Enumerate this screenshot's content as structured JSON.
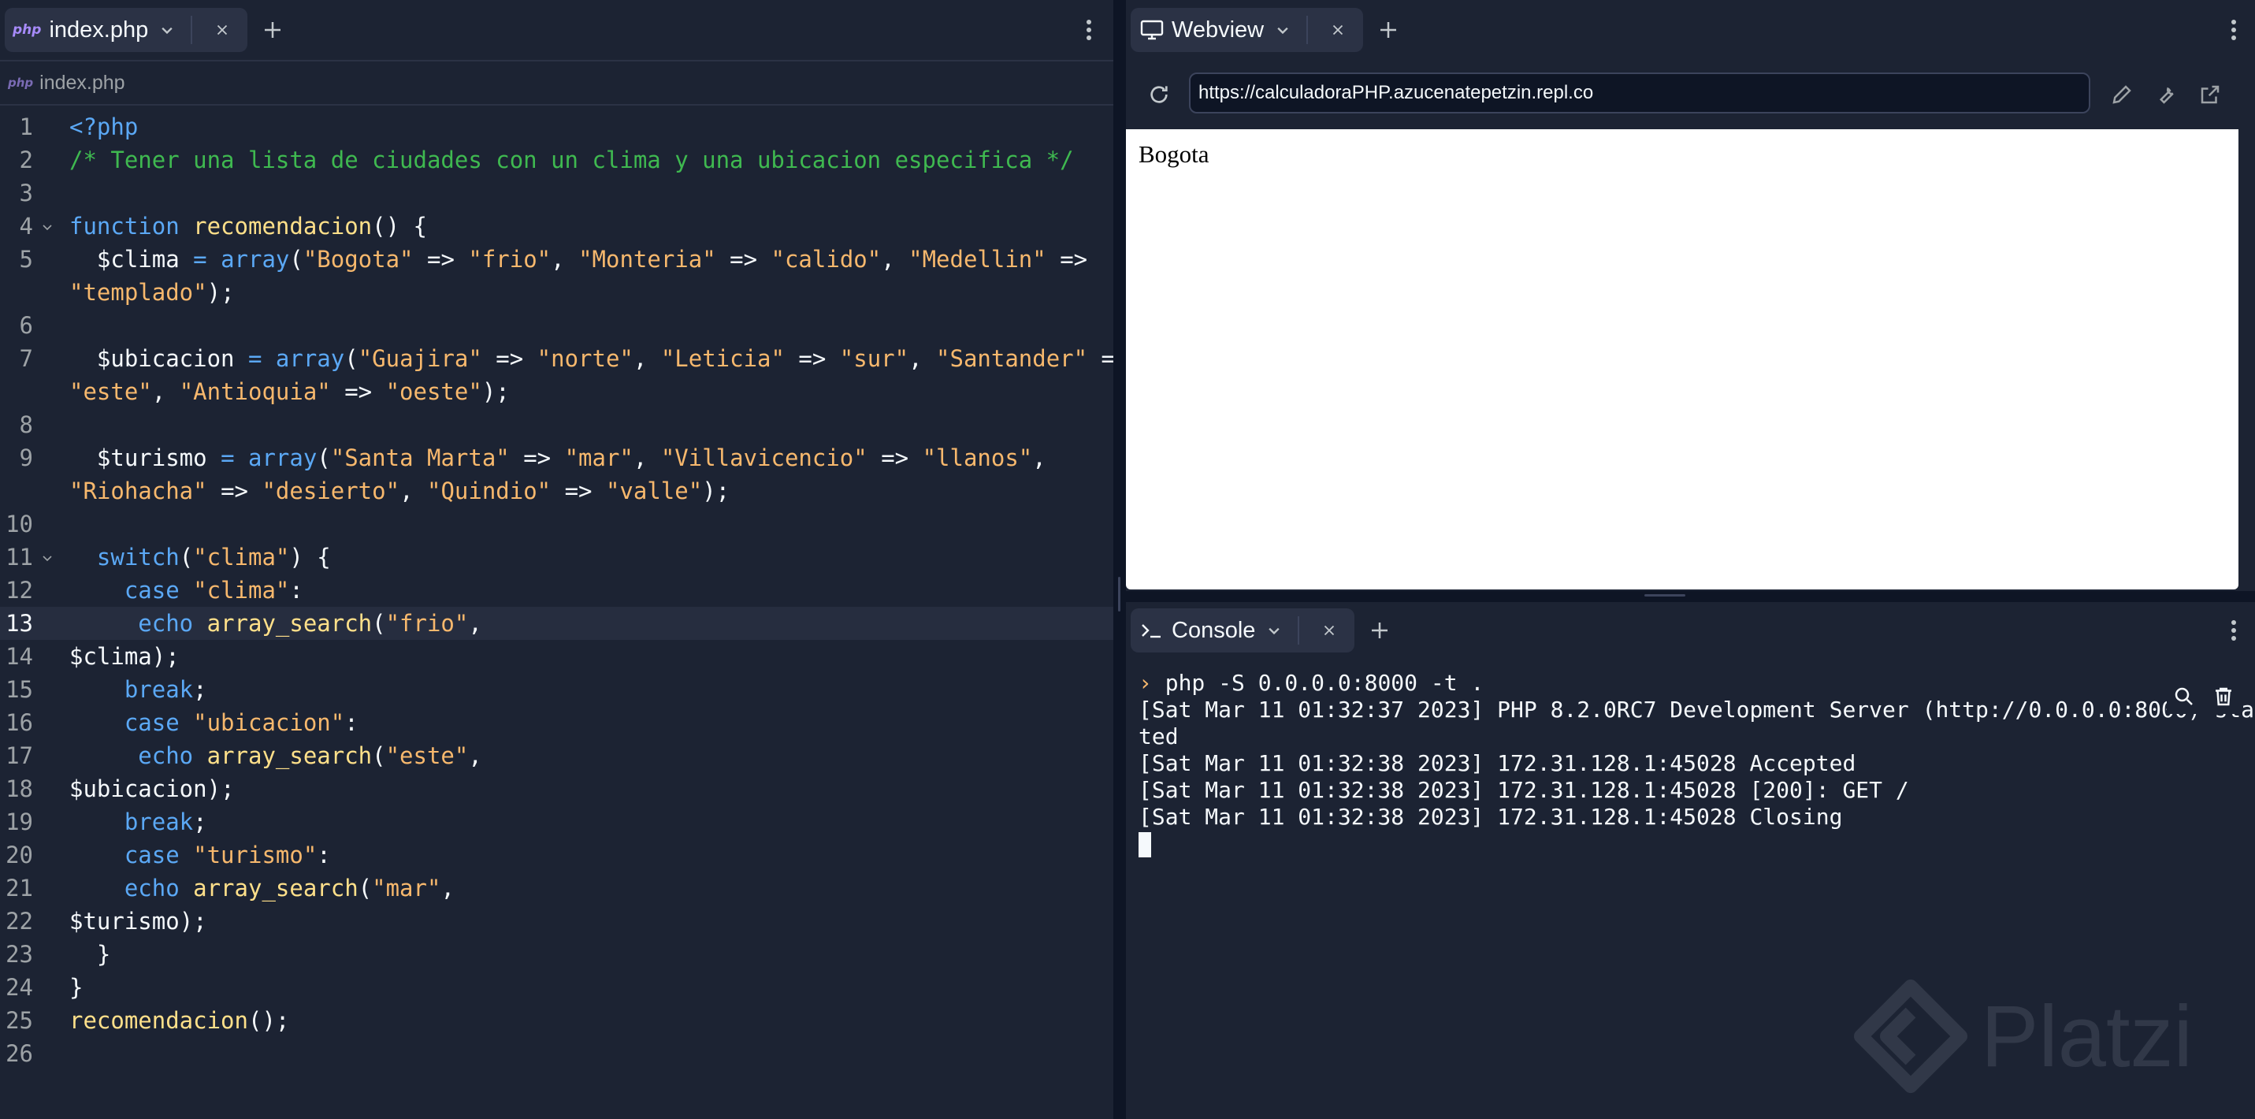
{
  "editor": {
    "tab_label": "index.php",
    "tab_badge": "php",
    "breadcrumb_badge": "php",
    "breadcrumb_label": "index.php",
    "code_lines": [
      {
        "n": "1",
        "fold": false,
        "tokens": [
          {
            "t": "kw",
            "v": "<?php"
          }
        ]
      },
      {
        "n": "2",
        "fold": false,
        "tokens": [
          {
            "t": "cm",
            "v": "/* Tener una lista de ciudades con un clima y una ubicacion especifica */"
          }
        ]
      },
      {
        "n": "3",
        "fold": false,
        "tokens": []
      },
      {
        "n": "4",
        "fold": true,
        "tokens": [
          {
            "t": "kw",
            "v": "function "
          },
          {
            "t": "fn",
            "v": "recomendacion"
          },
          {
            "t": "pn",
            "v": "() {"
          }
        ]
      },
      {
        "n": "5",
        "fold": false,
        "tokens": [
          {
            "t": "var",
            "v": "  $clima "
          },
          {
            "t": "kw",
            "v": "= "
          },
          {
            "t": "kw",
            "v": "array"
          },
          {
            "t": "pn",
            "v": "("
          },
          {
            "t": "str",
            "v": "\"Bogota\""
          },
          {
            "t": "pn",
            "v": " => "
          },
          {
            "t": "str",
            "v": "\"frio\""
          },
          {
            "t": "pn",
            "v": ", "
          },
          {
            "t": "str",
            "v": "\"Monteria\""
          },
          {
            "t": "pn",
            "v": " => "
          },
          {
            "t": "str",
            "v": "\"calido\""
          },
          {
            "t": "pn",
            "v": ", "
          },
          {
            "t": "str",
            "v": "\"Medellin\""
          },
          {
            "t": "pn",
            "v": " =>"
          }
        ]
      },
      {
        "n": "",
        "fold": false,
        "tokens": [
          {
            "t": "str",
            "v": "\"templado\""
          },
          {
            "t": "pn",
            "v": ");"
          }
        ]
      },
      {
        "n": "6",
        "fold": false,
        "tokens": []
      },
      {
        "n": "7",
        "fold": false,
        "tokens": [
          {
            "t": "var",
            "v": "  $ubicacion "
          },
          {
            "t": "kw",
            "v": "= "
          },
          {
            "t": "kw",
            "v": "array"
          },
          {
            "t": "pn",
            "v": "("
          },
          {
            "t": "str",
            "v": "\"Guajira\""
          },
          {
            "t": "pn",
            "v": " => "
          },
          {
            "t": "str",
            "v": "\"norte\""
          },
          {
            "t": "pn",
            "v": ", "
          },
          {
            "t": "str",
            "v": "\"Leticia\""
          },
          {
            "t": "pn",
            "v": " => "
          },
          {
            "t": "str",
            "v": "\"sur\""
          },
          {
            "t": "pn",
            "v": ", "
          },
          {
            "t": "str",
            "v": "\"Santander\""
          },
          {
            "t": "pn",
            "v": " =>"
          }
        ]
      },
      {
        "n": "",
        "fold": false,
        "tokens": [
          {
            "t": "str",
            "v": "\"este\""
          },
          {
            "t": "pn",
            "v": ", "
          },
          {
            "t": "str",
            "v": "\"Antioquia\""
          },
          {
            "t": "pn",
            "v": " => "
          },
          {
            "t": "str",
            "v": "\"oeste\""
          },
          {
            "t": "pn",
            "v": ");"
          }
        ]
      },
      {
        "n": "8",
        "fold": false,
        "tokens": []
      },
      {
        "n": "9",
        "fold": false,
        "tokens": [
          {
            "t": "var",
            "v": "  $turismo "
          },
          {
            "t": "kw",
            "v": "= "
          },
          {
            "t": "kw",
            "v": "array"
          },
          {
            "t": "pn",
            "v": "("
          },
          {
            "t": "str",
            "v": "\"Santa Marta\""
          },
          {
            "t": "pn",
            "v": " => "
          },
          {
            "t": "str",
            "v": "\"mar\""
          },
          {
            "t": "pn",
            "v": ", "
          },
          {
            "t": "str",
            "v": "\"Villavicencio\""
          },
          {
            "t": "pn",
            "v": " => "
          },
          {
            "t": "str",
            "v": "\"llanos\""
          },
          {
            "t": "pn",
            "v": ","
          }
        ]
      },
      {
        "n": "",
        "fold": false,
        "tokens": [
          {
            "t": "str",
            "v": "\"Riohacha\""
          },
          {
            "t": "pn",
            "v": " => "
          },
          {
            "t": "str",
            "v": "\"desierto\""
          },
          {
            "t": "pn",
            "v": ", "
          },
          {
            "t": "str",
            "v": "\"Quindio\""
          },
          {
            "t": "pn",
            "v": " => "
          },
          {
            "t": "str",
            "v": "\"valle\""
          },
          {
            "t": "pn",
            "v": ");"
          }
        ]
      },
      {
        "n": "10",
        "fold": false,
        "tokens": []
      },
      {
        "n": "11",
        "fold": true,
        "tokens": [
          {
            "t": "kw",
            "v": "  switch"
          },
          {
            "t": "pn",
            "v": "("
          },
          {
            "t": "str",
            "v": "\"clima\""
          },
          {
            "t": "pn",
            "v": ") {"
          }
        ]
      },
      {
        "n": "12",
        "fold": false,
        "tokens": [
          {
            "t": "kw",
            "v": "    case "
          },
          {
            "t": "str",
            "v": "\"clima\""
          },
          {
            "t": "pn",
            "v": ":"
          }
        ]
      },
      {
        "n": "13",
        "fold": false,
        "active": true,
        "tokens": [
          {
            "t": "kw",
            "v": "     echo "
          },
          {
            "t": "fn",
            "v": "array_search"
          },
          {
            "t": "pn",
            "v": "("
          },
          {
            "t": "str",
            "v": "\"frio\""
          },
          {
            "t": "pn",
            "v": ","
          }
        ]
      },
      {
        "n": "14",
        "fold": false,
        "tokens": [
          {
            "t": "var",
            "v": "$clima"
          },
          {
            "t": "pn",
            "v": ");"
          }
        ]
      },
      {
        "n": "15",
        "fold": false,
        "tokens": [
          {
            "t": "kw",
            "v": "    break"
          },
          {
            "t": "pn",
            "v": ";"
          }
        ]
      },
      {
        "n": "16",
        "fold": false,
        "tokens": [
          {
            "t": "kw",
            "v": "    case "
          },
          {
            "t": "str",
            "v": "\"ubicacion\""
          },
          {
            "t": "pn",
            "v": ":"
          }
        ]
      },
      {
        "n": "17",
        "fold": false,
        "tokens": [
          {
            "t": "kw",
            "v": "     echo "
          },
          {
            "t": "fn",
            "v": "array_search"
          },
          {
            "t": "pn",
            "v": "("
          },
          {
            "t": "str",
            "v": "\"este\""
          },
          {
            "t": "pn",
            "v": ","
          }
        ]
      },
      {
        "n": "18",
        "fold": false,
        "tokens": [
          {
            "t": "var",
            "v": "$ubicacion"
          },
          {
            "t": "pn",
            "v": ");"
          }
        ]
      },
      {
        "n": "19",
        "fold": false,
        "tokens": [
          {
            "t": "kw",
            "v": "    break"
          },
          {
            "t": "pn",
            "v": ";"
          }
        ]
      },
      {
        "n": "20",
        "fold": false,
        "tokens": [
          {
            "t": "kw",
            "v": "    case "
          },
          {
            "t": "str",
            "v": "\"turismo\""
          },
          {
            "t": "pn",
            "v": ":"
          }
        ]
      },
      {
        "n": "21",
        "fold": false,
        "tokens": [
          {
            "t": "kw",
            "v": "    echo "
          },
          {
            "t": "fn",
            "v": "array_search"
          },
          {
            "t": "pn",
            "v": "("
          },
          {
            "t": "str",
            "v": "\"mar\""
          },
          {
            "t": "pn",
            "v": ","
          }
        ]
      },
      {
        "n": "22",
        "fold": false,
        "tokens": [
          {
            "t": "var",
            "v": "$turismo"
          },
          {
            "t": "pn",
            "v": ");"
          }
        ]
      },
      {
        "n": "23",
        "fold": false,
        "tokens": [
          {
            "t": "pn",
            "v": "  }"
          }
        ]
      },
      {
        "n": "24",
        "fold": false,
        "tokens": [
          {
            "t": "pn",
            "v": "}"
          }
        ]
      },
      {
        "n": "25",
        "fold": false,
        "tokens": [
          {
            "t": "fn",
            "v": "recomendacion"
          },
          {
            "t": "pn",
            "v": "();"
          }
        ]
      },
      {
        "n": "26",
        "fold": false,
        "tokens": []
      }
    ]
  },
  "webview": {
    "tab_label": "Webview",
    "url": "https://calculadoraPHP.azucenatepetzin.repl.co",
    "page_text": "Bogota"
  },
  "console": {
    "tab_label": "Console",
    "command": "php -S 0.0.0.0:8000 -t .",
    "output_lines": [
      "[Sat Mar 11 01:32:37 2023] PHP 8.2.0RC7 Development Server (http://0.0.0.0:8000) star",
      "ted",
      "[Sat Mar 11 01:32:38 2023] 172.31.128.1:45028 Accepted",
      "[Sat Mar 11 01:32:38 2023] 172.31.128.1:45028 [200]: GET /",
      "[Sat Mar 11 01:32:38 2023] 172.31.128.1:45028 Closing"
    ]
  },
  "watermark": {
    "text": "Platzi"
  },
  "colors": {
    "background": "#1c2333",
    "keyword": "#5ba8f5",
    "function": "#ffe08a",
    "string": "#f7b86d",
    "comment": "#3fb950",
    "line_number": "#9da2a6",
    "php_badge": "#a78bfa"
  },
  "icons": [
    "chevron-down-icon",
    "close-icon",
    "plus-icon",
    "kebab-icon",
    "monitor-icon",
    "refresh-icon",
    "pencil-icon",
    "wrench-icon",
    "external-link-icon",
    "terminal-icon",
    "search-icon",
    "trash-icon"
  ]
}
